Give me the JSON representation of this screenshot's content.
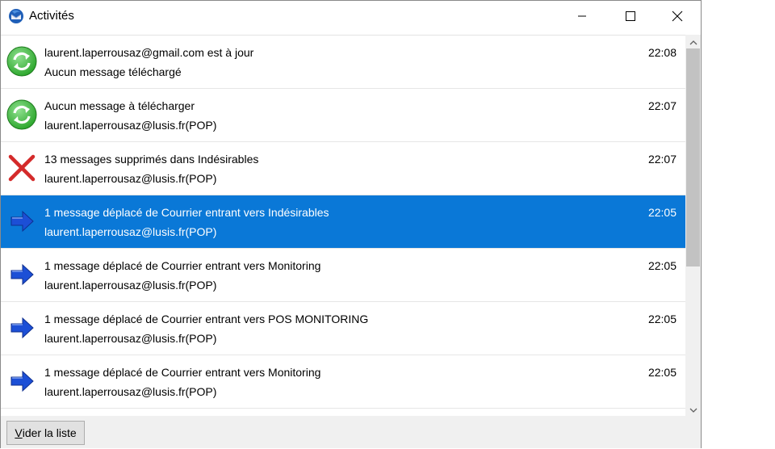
{
  "window": {
    "title": "Activités",
    "app_icon": "thunderbird-icon",
    "controls": [
      "minimize-icon",
      "maximize-icon",
      "close-icon"
    ]
  },
  "activities": [
    {
      "icon": "sync-icon",
      "line1": "laurent.laperrousaz@gmail.com est à jour",
      "line2": "Aucun message téléchargé",
      "time": "22:08",
      "selected": false
    },
    {
      "icon": "sync-icon",
      "line1": "Aucun message à télécharger",
      "line2": "laurent.laperrousaz@lusis.fr(POP)",
      "time": "22:07",
      "selected": false
    },
    {
      "icon": "delete-x-icon",
      "line1": "13 messages supprimés dans Indésirables",
      "line2": "laurent.laperrousaz@lusis.fr(POP)",
      "time": "22:07",
      "selected": false
    },
    {
      "icon": "move-arrow-icon",
      "line1": "1 message déplacé de Courrier entrant vers Indésirables",
      "line2": "laurent.laperrousaz@lusis.fr(POP)",
      "time": "22:05",
      "selected": true
    },
    {
      "icon": "move-arrow-icon",
      "line1": "1 message déplacé de Courrier entrant vers Monitoring",
      "line2": "laurent.laperrousaz@lusis.fr(POP)",
      "time": "22:05",
      "selected": false
    },
    {
      "icon": "move-arrow-icon",
      "line1": "1 message déplacé de Courrier entrant vers POS MONITORING",
      "line2": "laurent.laperrousaz@lusis.fr(POP)",
      "time": "22:05",
      "selected": false
    },
    {
      "icon": "move-arrow-icon",
      "line1": "1 message déplacé de Courrier entrant vers Monitoring",
      "line2": "laurent.laperrousaz@lusis.fr(POP)",
      "time": "22:05",
      "selected": false
    }
  ],
  "footer": {
    "clear_accesskey": "V",
    "clear_rest": "ider la liste"
  },
  "colors": {
    "selection": "#0a78d7",
    "sync_green": "#2fa82f",
    "delete_red": "#d42a2a",
    "arrow_blue": "#1c4fd6"
  }
}
